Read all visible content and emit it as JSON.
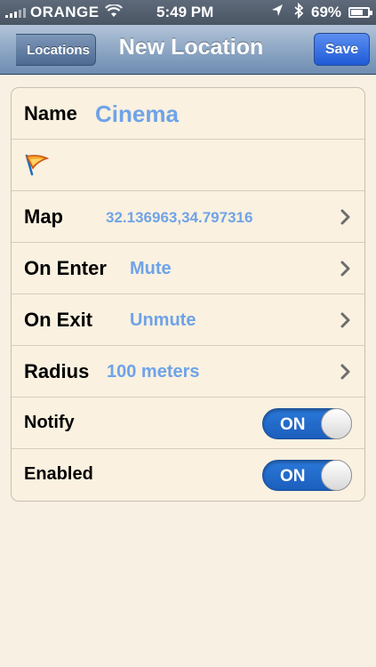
{
  "status_bar": {
    "carrier": "ORANGE",
    "time": "5:49 PM",
    "battery": "69%"
  },
  "nav": {
    "back_label": "Locations",
    "title": "New Location",
    "save_label": "Save"
  },
  "form": {
    "name_label": "Name",
    "name_value": "Cinema",
    "map_label": "Map",
    "map_value": "32.136963,34.797316",
    "on_enter_label": "On Enter",
    "on_enter_value": "Mute",
    "on_exit_label": "On Exit",
    "on_exit_value": "Unmute",
    "radius_label": "Radius",
    "radius_value": "100 meters",
    "notify_label": "Notify",
    "notify_state": "ON",
    "enabled_label": "Enabled",
    "enabled_state": "ON"
  },
  "colors": {
    "value_blue": "#6fa3e8",
    "background": "#f8f1e3",
    "toggle_on": "#2a78d9"
  }
}
